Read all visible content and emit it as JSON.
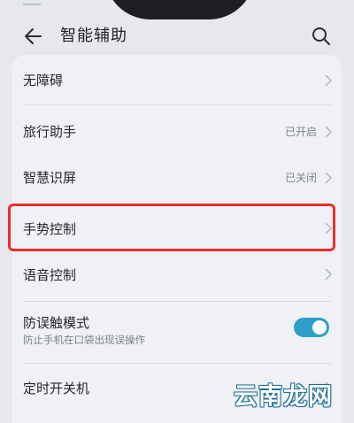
{
  "header": {
    "title": "智能辅助",
    "back_icon": "back-arrow-icon",
    "search_icon": "search-icon"
  },
  "rows": [
    {
      "label": "无障碍",
      "status": ""
    },
    {
      "label": "旅行助手",
      "status": "已开启"
    },
    {
      "label": "智慧识屏",
      "status": "已关闭"
    },
    {
      "label": "手势控制",
      "status": ""
    },
    {
      "label": "语音控制",
      "status": ""
    },
    {
      "label": "防误触模式",
      "sub": "防止手机在口袋出现误操作",
      "toggle_on": true
    },
    {
      "label": "定时开关机",
      "status": ""
    }
  ],
  "colors": {
    "accent": "#2f9ec9",
    "highlight": "#ee2d2d",
    "background": "#e6e8ee",
    "card": "#eff1f5"
  },
  "watermark": {
    "text": "云南龙网"
  }
}
